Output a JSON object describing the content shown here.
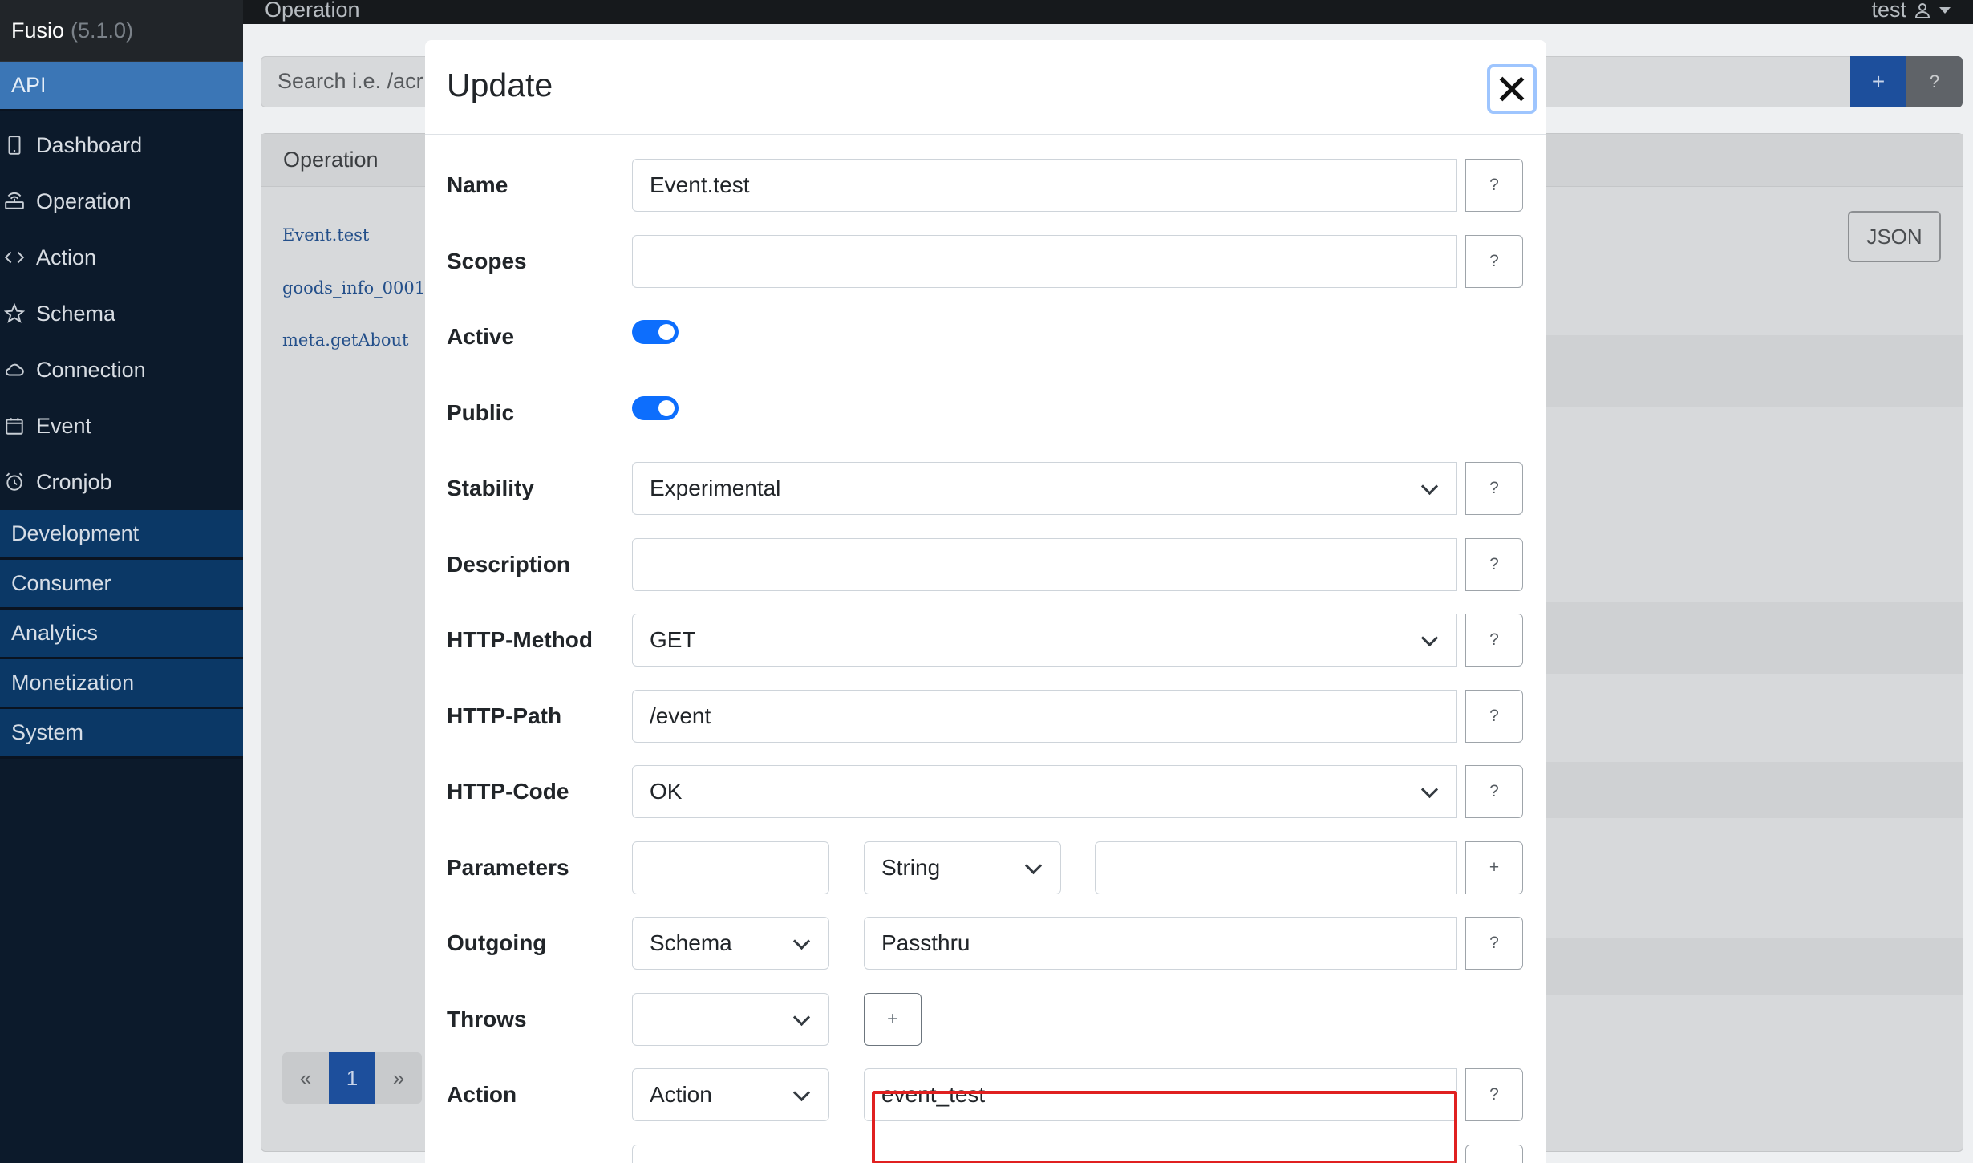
{
  "app": {
    "name": "Fusio",
    "version": "(5.1.0)"
  },
  "topbar": {
    "title": "Operation",
    "user": "test"
  },
  "sidebar": {
    "api_section": "API",
    "items": [
      {
        "label": "Dashboard",
        "icon": "tablet-icon"
      },
      {
        "label": "Operation",
        "icon": "router-icon"
      },
      {
        "label": "Action",
        "icon": "code-icon"
      },
      {
        "label": "Schema",
        "icon": "star-icon"
      },
      {
        "label": "Connection",
        "icon": "cloud-icon"
      },
      {
        "label": "Event",
        "icon": "calendar-icon"
      },
      {
        "label": "Cronjob",
        "icon": "alarm-icon"
      }
    ],
    "sections": [
      "Development",
      "Consumer",
      "Analytics",
      "Monetization",
      "System"
    ]
  },
  "background": {
    "search_placeholder": "Search i.e. /acr",
    "add_label": "+",
    "help_label": "?",
    "panel_title": "Operation",
    "links": [
      "Event.test",
      "goods_info_0001",
      "meta.getAbout"
    ],
    "json_button": "JSON",
    "pagination": {
      "prev": "«",
      "page": "1",
      "next": "»"
    }
  },
  "modal": {
    "title": "Update",
    "help_label": "?",
    "plus_label": "+",
    "fields": {
      "name": {
        "label": "Name",
        "value": "Event.test"
      },
      "scopes": {
        "label": "Scopes",
        "value": ""
      },
      "active": {
        "label": "Active",
        "checked": true
      },
      "public": {
        "label": "Public",
        "checked": true
      },
      "stability": {
        "label": "Stability",
        "value": "Experimental"
      },
      "description": {
        "label": "Description",
        "value": ""
      },
      "http_method": {
        "label": "HTTP-Method",
        "value": "GET"
      },
      "http_path": {
        "label": "HTTP-Path",
        "value": "/event"
      },
      "http_code": {
        "label": "HTTP-Code",
        "value": "OK"
      },
      "parameters": {
        "label": "Parameters",
        "name": "",
        "type": "String",
        "description": ""
      },
      "outgoing": {
        "label": "Outgoing",
        "type": "Schema",
        "value": "Passthru"
      },
      "throws": {
        "label": "Throws",
        "value": ""
      },
      "action": {
        "label": "Action",
        "type": "Action",
        "value": "event_test"
      }
    }
  },
  "colors": {
    "primary": "#0d6efd",
    "sidebar_bg": "#0c1a2b",
    "highlight": "#e02020"
  }
}
